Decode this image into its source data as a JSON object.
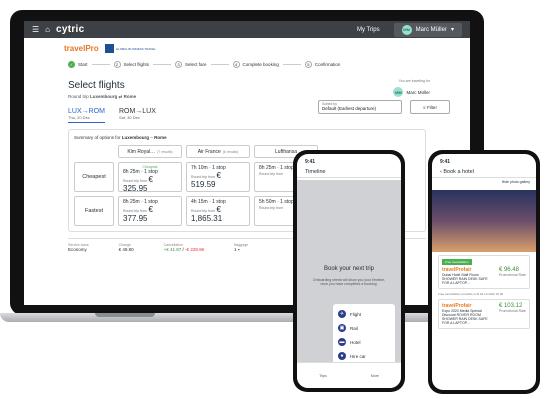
{
  "app": {
    "brand": "cytric",
    "my_trips": "My Trips",
    "user": "Marc Müller",
    "user_initials": "MM"
  },
  "logos": {
    "travelpro": "travelPro",
    "partner": "GLOBAL BUSINESS TRAVEL"
  },
  "steps": [
    {
      "num": "✓",
      "label": "Start",
      "done": true
    },
    {
      "num": "2",
      "label": "Select flights",
      "done": false
    },
    {
      "num": "3",
      "label": "Select fare",
      "done": false
    },
    {
      "num": "4",
      "label": "Complete booking",
      "done": false
    },
    {
      "num": "5",
      "label": "Confirmation",
      "done": false
    }
  ],
  "traveling_for": "You are traveling for",
  "page": {
    "title": "Select flights",
    "subtitle_prefix": "Round trip",
    "from": "Luxembourg",
    "to": "Rome"
  },
  "legs": [
    {
      "route": "LUX→ROM",
      "date": "Thu, 20 Dec"
    },
    {
      "route": "ROM→LUX",
      "date": "Sat, 30 Dec"
    }
  ],
  "sort": {
    "label": "Sorted by",
    "value": "Default (Earliest departure)"
  },
  "filter_label": "Filter",
  "summary": {
    "prefix": "Summary of options for",
    "city": "Luxembourg",
    "to": "Rome"
  },
  "airlines": [
    {
      "name": "Klm Royal…",
      "results": "(7 results)"
    },
    {
      "name": "Air France",
      "results": "(6 results)"
    },
    {
      "name": "Lufthansa",
      "results": ""
    }
  ],
  "rows": [
    {
      "label": "Cheapest",
      "cells": [
        {
          "tag": "Cheapest",
          "time": "8h 25m · 1 stop",
          "rt": "Round trip from",
          "price": "€ 325.95"
        },
        {
          "tag": "",
          "time": "7h 10m · 1 stop",
          "rt": "Round trip from",
          "price": "€ 519.59"
        },
        {
          "tag": "",
          "time": "8h 25m · 1 stop",
          "rt": "Round trip from",
          "price": ""
        }
      ]
    },
    {
      "label": "Fastest",
      "cells": [
        {
          "tag": "",
          "time": "8h 25m · 1 stop",
          "rt": "Round trip from",
          "price": "€ 377.95"
        },
        {
          "tag": "",
          "time": "4h 15m · 1 stop",
          "rt": "Round trip from",
          "price": "€ 1,865.31"
        },
        {
          "tag": "",
          "time": "5h 50m · 1 stop",
          "rt": "Round trip from",
          "price": ""
        }
      ]
    }
  ],
  "fare": {
    "class_label": "Service class",
    "class": "Economy",
    "change_label": "Change",
    "change": "€ 49.80",
    "cancel_label": "Cancellation",
    "cancel_a": "+€ 41.87",
    "cancel_b": "-€ 228.96",
    "baggage_label": "Baggage",
    "baggage": "1 ▪"
  },
  "phone1": {
    "time": "9:41",
    "title": "Timeline",
    "heading": "Book your next trip",
    "desc": "Onboarding needs will show you your timeline, once you have completed a booking.",
    "menu": [
      "Flight",
      "Rail",
      "Hotel",
      "Hire car"
    ],
    "tabs": [
      "Trips",
      "More"
    ]
  },
  "phone2": {
    "time": "9:41",
    "title": "Book a hotel",
    "gallery": "Hide photo gallery",
    "hotels": [
      {
        "free": "Free Cancellation",
        "brand": "travelProfair",
        "name": "Dubai Hotel Staff Room SHOWER RAIN DESK SAFE FOR A LAPTOP…",
        "price": "€ 96.48",
        "promo": "Promotional Rate"
      },
      {
        "free": "",
        "brand": "travelProfair",
        "name": "Expo 2020 Media Special Discount ROVER ROOM SHOWER RAIN DESK SAFE FOR A LAPTOP…",
        "price": "€ 103.12",
        "promo": "Promotional Rate"
      }
    ],
    "cancel_note": "Free cancellation possible until 20.10.2022 16:00"
  }
}
